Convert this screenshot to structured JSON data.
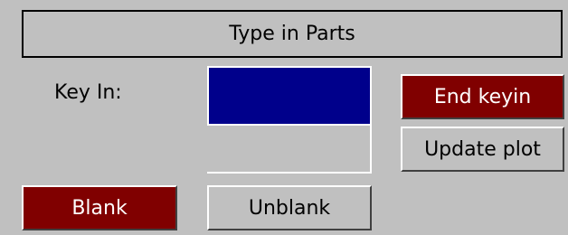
{
  "panel": {
    "title": "Type in Parts"
  },
  "key_in": {
    "label": "Key In:",
    "value": ""
  },
  "buttons": {
    "end_keyin": "End keyin",
    "update_plot": "Update plot",
    "blank": "Blank",
    "unblank": "Unblank"
  },
  "colors": {
    "background": "#c0c0c0",
    "active_button": "#800000",
    "input_field": "#00008b",
    "button_text_light": "#ffffff"
  }
}
